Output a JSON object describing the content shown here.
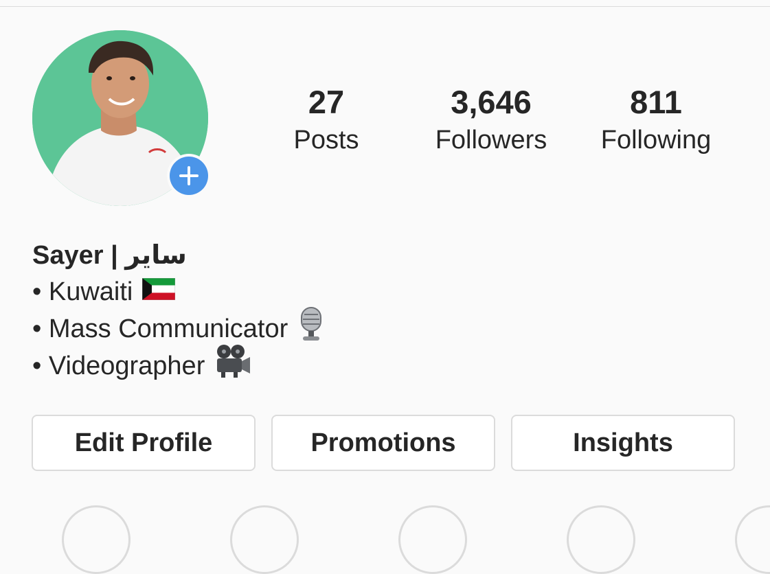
{
  "profile": {
    "name": "Sayer | ساير",
    "bio_lines": [
      {
        "text": "• Kuwaiti",
        "icon": "kuwait-flag-icon"
      },
      {
        "text": "• Mass Communicator",
        "icon": "microphone-icon"
      },
      {
        "text": "• Videographer",
        "icon": "movie-camera-icon"
      }
    ]
  },
  "stats": {
    "posts": {
      "value": "27",
      "label": "Posts"
    },
    "followers": {
      "value": "3,646",
      "label": "Followers"
    },
    "following": {
      "value": "811",
      "label": "Following"
    }
  },
  "actions": {
    "edit_profile": "Edit Profile",
    "promotions": "Promotions",
    "insights": "Insights"
  },
  "colors": {
    "avatar_bg": "#5cc596",
    "add_story": "#4b95e9",
    "text": "#262626",
    "border": "#dbdbdb"
  }
}
